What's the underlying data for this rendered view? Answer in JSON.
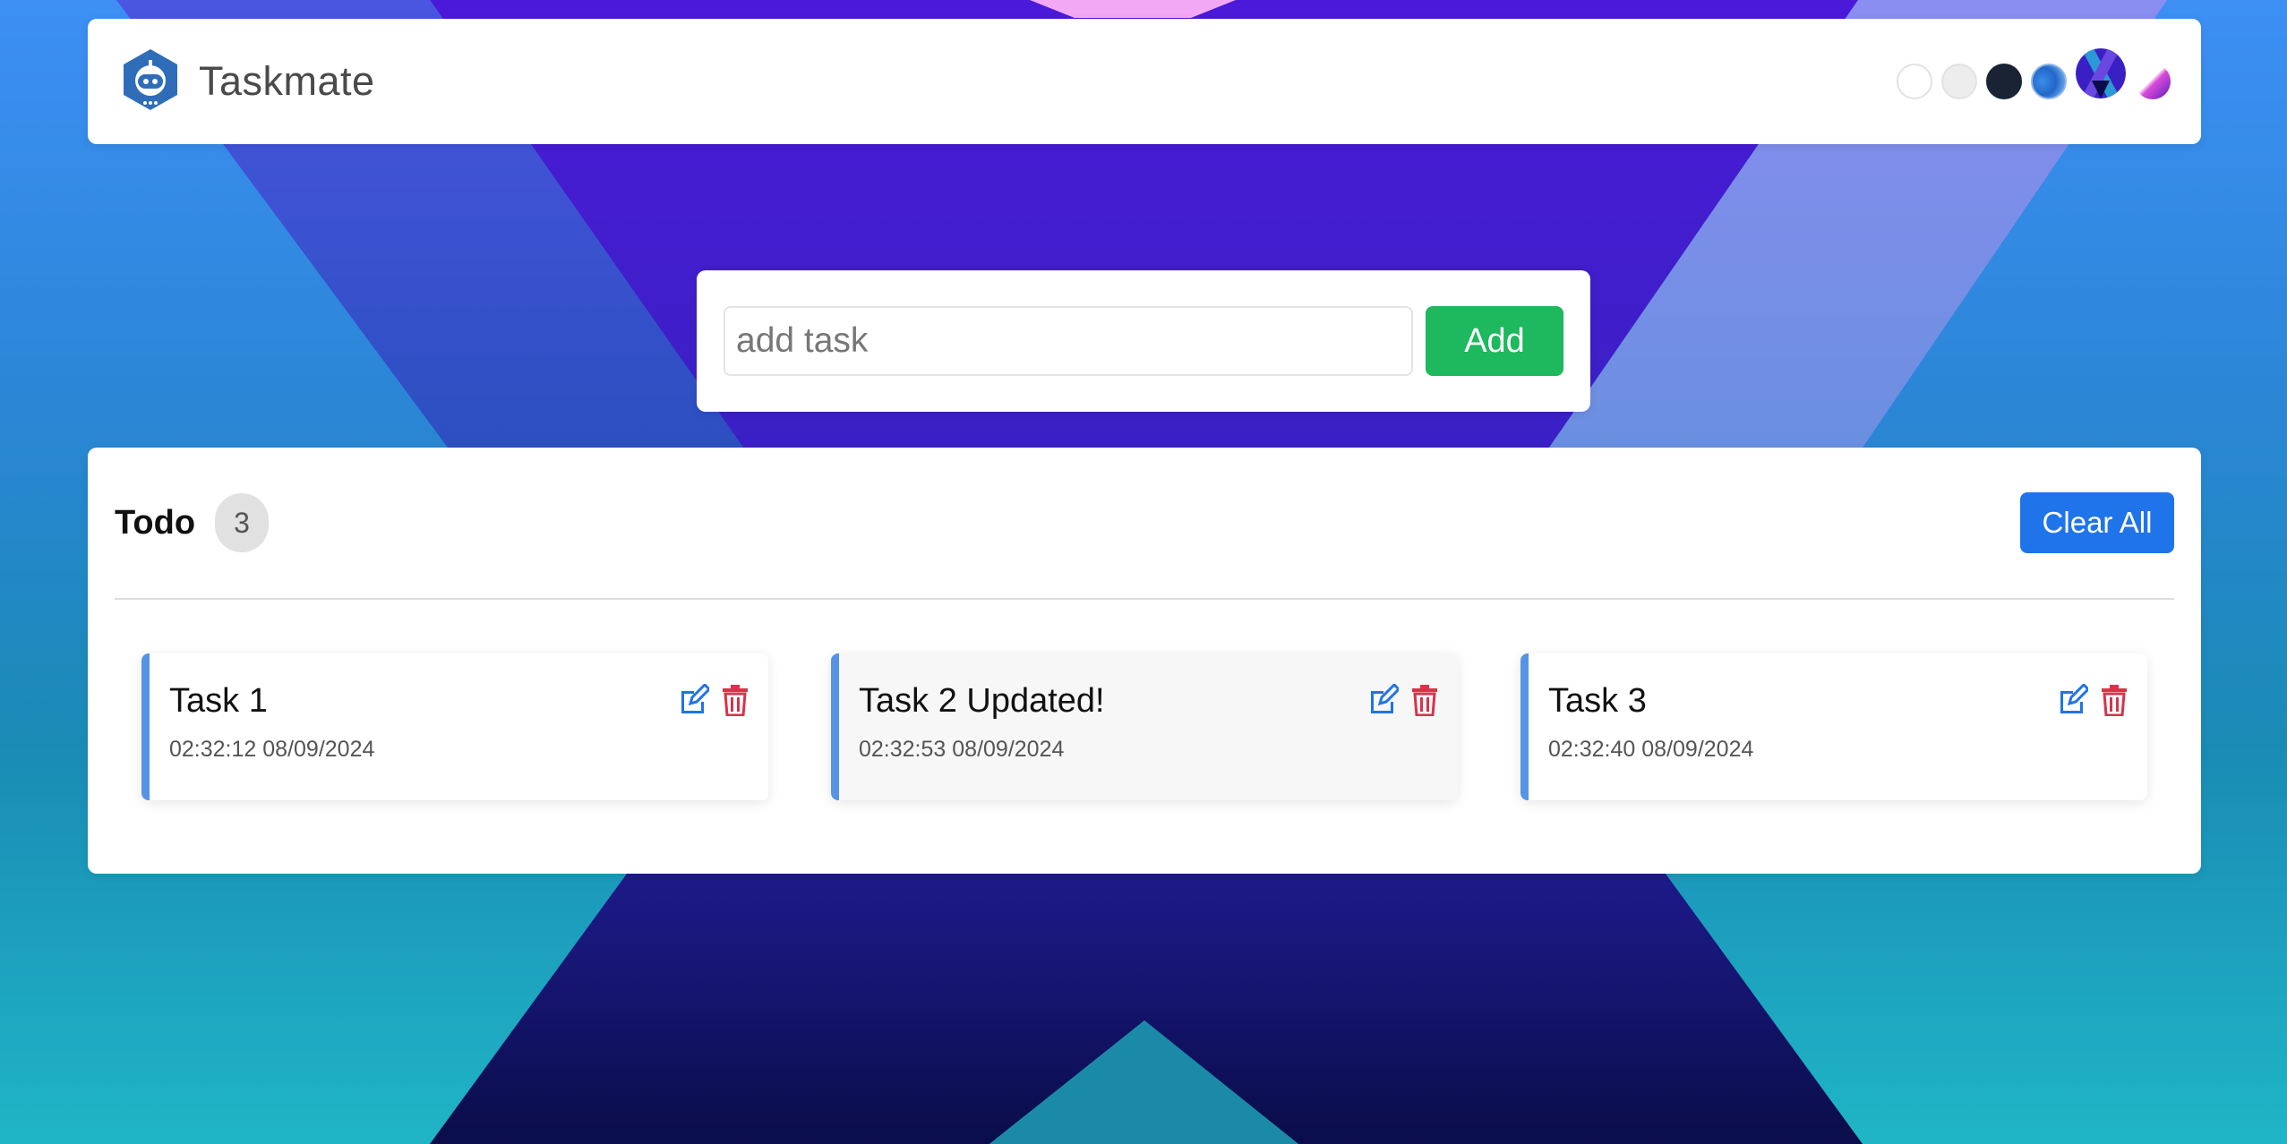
{
  "navbar": {
    "brand_name": "Taskmate",
    "themes": [
      "light",
      "gray",
      "dark",
      "blue",
      "x-gradient",
      "pink-gradient"
    ]
  },
  "add_task": {
    "placeholder": "add task",
    "button_label": "Add"
  },
  "todo": {
    "title": "Todo",
    "count": "3",
    "clear_label": "Clear All",
    "tasks": [
      {
        "name": "Task 1",
        "time": "02:32:12 08/09/2024"
      },
      {
        "name": "Task 2 Updated!",
        "time": "02:32:53 08/09/2024"
      },
      {
        "name": "Task 3",
        "time": "02:32:40 08/09/2024"
      }
    ]
  },
  "colors": {
    "accent_blue": "#1f74ea",
    "add_green": "#1eb85e",
    "delete_red": "#d8334a",
    "task_border": "#5594e4"
  },
  "icons": {
    "edit": "edit-icon",
    "delete": "trash-icon",
    "logo": "robot-logo-icon"
  }
}
